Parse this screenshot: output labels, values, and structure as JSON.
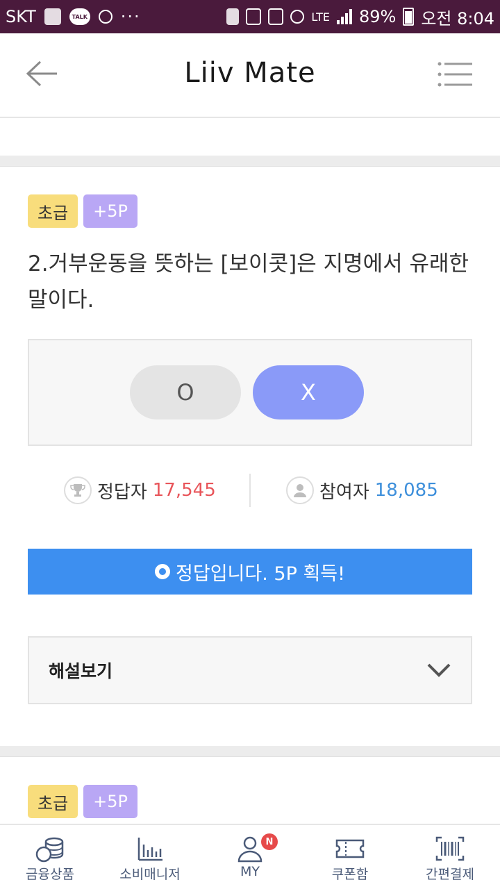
{
  "status_bar": {
    "carrier": "SKT",
    "talk": "TALK",
    "dots": "···",
    "network": "LTE",
    "battery": "89%",
    "time": "오전 8:04"
  },
  "header": {
    "title": "Liiv Mate"
  },
  "quiz": {
    "level_badge": "초급",
    "point_badge": "+5P",
    "question": "2.거부운동을 뜻하는 [보이콧]은 지명에서 유래한 말이다.",
    "option_o": "O",
    "option_x": "X",
    "selected": "X",
    "correct_label": "정답자",
    "correct_count": "17,545",
    "participant_label": "참여자",
    "participant_count": "18,085",
    "result_message": "정답입니다. 5P 획득!",
    "explanation_label": "해설보기"
  },
  "next_quiz": {
    "level_badge": "초급",
    "point_badge": "+5P"
  },
  "bottom_nav": {
    "items": [
      {
        "label": "금융상품",
        "icon": "coins-icon"
      },
      {
        "label": "소비매니저",
        "icon": "bar-chart-icon"
      },
      {
        "label": "MY",
        "icon": "person-icon",
        "badge": "N"
      },
      {
        "label": "쿠폰함",
        "icon": "ticket-icon"
      },
      {
        "label": "간편결제",
        "icon": "barcode-icon"
      }
    ]
  },
  "colors": {
    "status_bar": "#4a1a3c",
    "accent_blue": "#3d8ff0",
    "x_button": "#8a9af8",
    "level_badge": "#f8dd7c",
    "point_badge": "#b9a7f5",
    "correct_red": "#e8555a",
    "participant_blue": "#3d8fdb"
  }
}
